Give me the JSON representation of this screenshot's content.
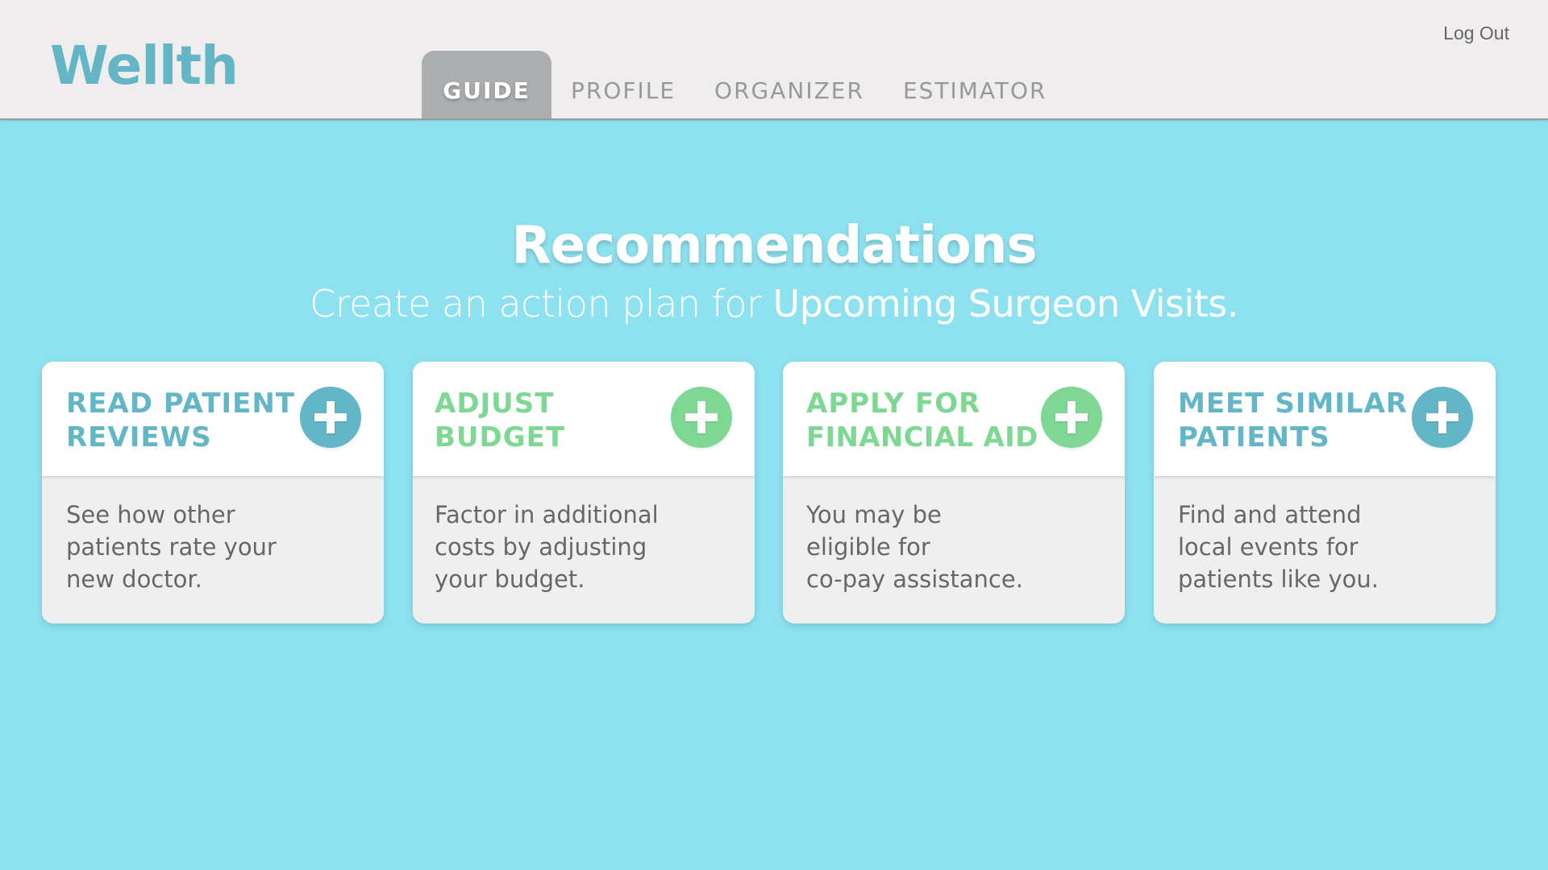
{
  "app": {
    "name": "Wellth"
  },
  "header": {
    "logo": "Wellth",
    "logout_label": "Log Out",
    "tabs": [
      {
        "label": "GUIDE",
        "active": true
      },
      {
        "label": "PROFILE",
        "active": false
      },
      {
        "label": "ORGANIZER",
        "active": false
      },
      {
        "label": "ESTIMATOR",
        "active": false
      }
    ]
  },
  "main": {
    "title": "Recommendations",
    "subtitle_prefix": "Create an action plan for ",
    "subtitle_highlight": "Upcoming Surgeon Visits."
  },
  "cards": [
    {
      "title_line1": "READ PATIENT",
      "title_line2": "REVIEWS",
      "accent": "#62B6C6",
      "icon": "plus-icon",
      "desc_lines": [
        "See how other",
        "patients rate your",
        "new doctor."
      ]
    },
    {
      "title_line1": "ADJUST",
      "title_line2": "BUDGET",
      "accent": "#7ED893",
      "icon": "plus-icon",
      "desc_lines": [
        "Factor in additional",
        "costs by adjusting",
        "your budget."
      ]
    },
    {
      "title_line1": "APPLY FOR",
      "title_line2": "FINANCIAL AID",
      "accent": "#7ED893",
      "icon": "plus-icon",
      "desc_lines": [
        "You may be",
        "eligible for",
        "co-pay assistance."
      ]
    },
    {
      "title_line1": "MEET SIMILAR",
      "title_line2": "PATIENTS",
      "accent": "#62B6C6",
      "icon": "plus-icon",
      "desc_lines": [
        "Find and attend",
        "local events for",
        "patients like you."
      ]
    }
  ],
  "colors": {
    "background": "#8EE2EF",
    "header": "#EFEDEE",
    "teal": "#62B6C6",
    "green": "#7ED893",
    "active_tab": "#ADAEAF"
  }
}
